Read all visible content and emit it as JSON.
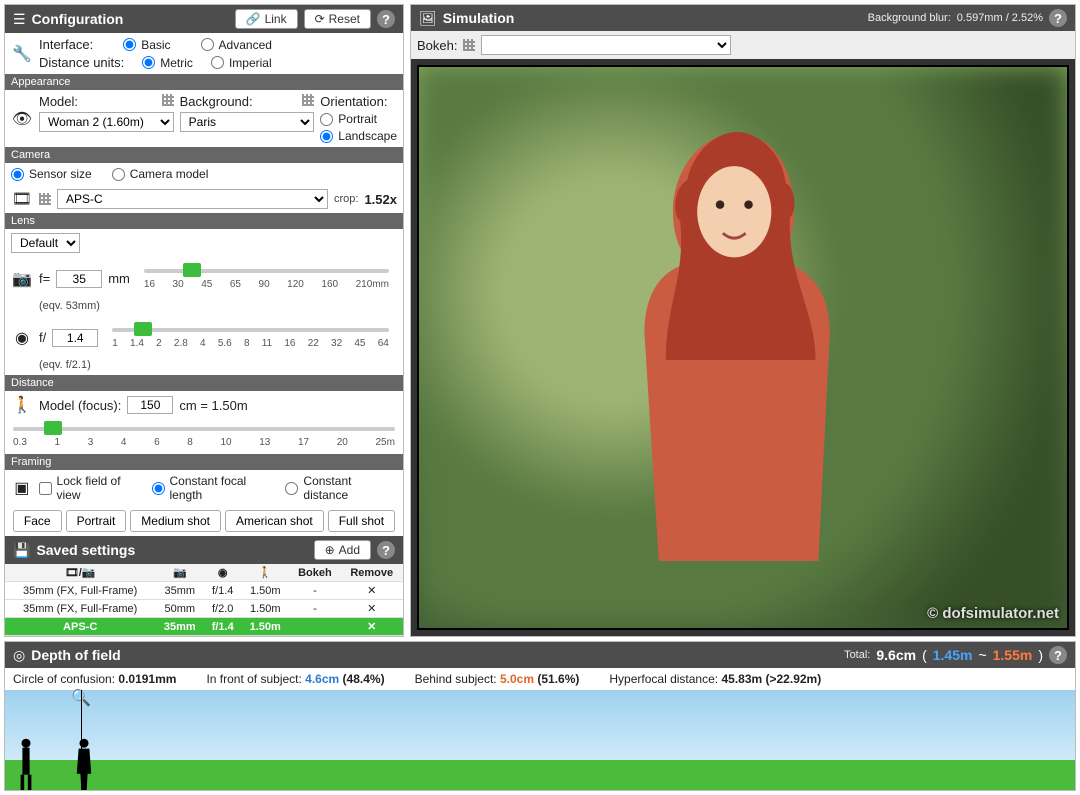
{
  "config": {
    "title": "Configuration",
    "link_btn": "Link",
    "reset_btn": "Reset",
    "interface_label": "Interface:",
    "basic": "Basic",
    "advanced": "Advanced",
    "distance_units_label": "Distance units:",
    "metric": "Metric",
    "imperial": "Imperial"
  },
  "appearance": {
    "header": "Appearance",
    "model_label": "Model:",
    "model_value": "Woman 2 (1.60m)",
    "background_label": "Background:",
    "background_value": "Paris",
    "orientation_label": "Orientation:",
    "portrait": "Portrait",
    "landscape": "Landscape"
  },
  "camera": {
    "header": "Camera",
    "sensor_size": "Sensor size",
    "camera_model": "Camera model",
    "sensor_value": "APS-C",
    "crop_label": "crop:",
    "crop_value": "1.52x"
  },
  "lens": {
    "header": "Lens",
    "preset": "Default",
    "focal_prefix": "f=",
    "focal_value": "35",
    "focal_unit": "mm",
    "focal_eqv": "(eqv. 53mm)",
    "focal_ticks": [
      "16",
      "30",
      "45",
      "65",
      "90",
      "120",
      "160",
      "210mm"
    ],
    "aperture_prefix": "f/",
    "aperture_value": "1.4",
    "aperture_eqv": "(eqv. f/2.1)",
    "aperture_ticks": [
      "1",
      "1.4",
      "2",
      "2.8",
      "4",
      "5.6",
      "8",
      "11",
      "16",
      "22",
      "32",
      "45",
      "64"
    ]
  },
  "distance": {
    "header": "Distance",
    "label": "Model (focus):",
    "value": "150",
    "unit_text": "cm = 1.50m",
    "ticks": [
      "0.3",
      "1",
      "3",
      "4",
      "6",
      "8",
      "10",
      "13",
      "17",
      "20",
      "25m"
    ]
  },
  "framing": {
    "header": "Framing",
    "lock_fov": "Lock field of view",
    "constant_focal": "Constant focal length",
    "constant_distance": "Constant distance",
    "presets": [
      "Face",
      "Portrait",
      "Medium shot",
      "American shot",
      "Full shot"
    ]
  },
  "saved": {
    "header": "Saved settings",
    "add": "Add",
    "cols": {
      "bokeh": "Bokeh",
      "remove": "Remove"
    },
    "rows": [
      {
        "sensor": "35mm (FX, Full-Frame)",
        "focal": "35mm",
        "ap": "f/1.4",
        "dist": "1.50m",
        "bokeh": "-",
        "active": false
      },
      {
        "sensor": "35mm (FX, Full-Frame)",
        "focal": "50mm",
        "ap": "f/2.0",
        "dist": "1.50m",
        "bokeh": "-",
        "active": false
      },
      {
        "sensor": "APS-C",
        "focal": "35mm",
        "ap": "f/1.4",
        "dist": "1.50m",
        "bokeh": "",
        "active": true
      }
    ]
  },
  "sim": {
    "header": "Simulation",
    "bg_blur_label": "Background blur:",
    "bg_blur_value": "0.597mm / 2.52%",
    "bokeh_label": "Bokeh:",
    "watermark": "© dofsimulator.net"
  },
  "dof": {
    "header": "Depth of field",
    "total_label": "Total:",
    "total_value": "9.6cm",
    "near": "1.45m",
    "tilde": "~",
    "far": "1.55m",
    "coc_label": "Circle of confusion:",
    "coc_value": "0.0191mm",
    "front_label": "In front of subject:",
    "front_value": "4.6cm",
    "front_pct": "(48.4%)",
    "behind_label": "Behind subject:",
    "behind_value": "5.0cm",
    "behind_pct": "(51.6%)",
    "hyper_label": "Hyperfocal distance:",
    "hyper_value": "45.83m (>22.92m)"
  }
}
